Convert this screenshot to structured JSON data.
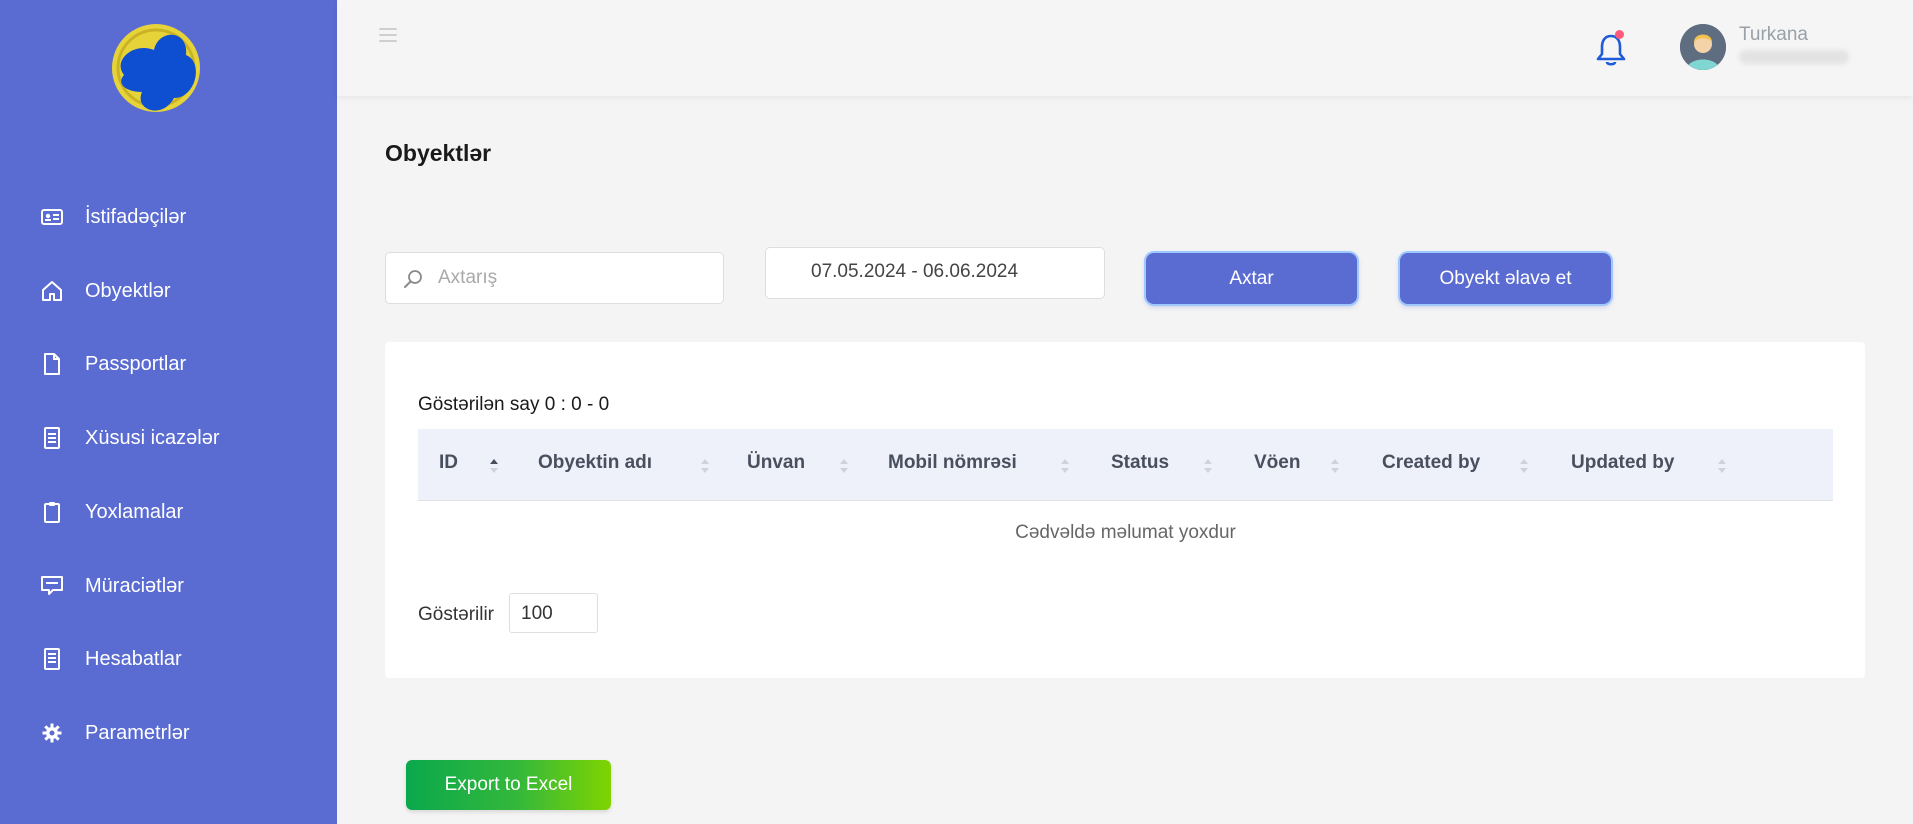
{
  "colors": {
    "sidebar": "#5a6bd1",
    "primary_button": "#5a6bd1",
    "excel_button": "#0aa84d",
    "notification_dot": "#ff5a7a"
  },
  "sidebar": {
    "logo": "logo-emblem",
    "items": [
      {
        "label": "İstifadəçilər",
        "icon": "id-card-icon"
      },
      {
        "label": "Obyektlər",
        "icon": "home-icon"
      },
      {
        "label": "Passportlar",
        "icon": "document-icon"
      },
      {
        "label": "Xüsusi icazələr",
        "icon": "list-document-icon"
      },
      {
        "label": "Yoxlamalar",
        "icon": "clipboard-icon"
      },
      {
        "label": "Müraciətlər",
        "icon": "message-icon"
      },
      {
        "label": "Hesabatlar",
        "icon": "report-icon"
      },
      {
        "label": "Parametrlər",
        "icon": "gear-icon"
      }
    ]
  },
  "header": {
    "menu_icon": "hamburger-icon",
    "notification_icon": "bell-icon",
    "user": {
      "name": "Turkana"
    }
  },
  "page": {
    "title": "Obyektlər"
  },
  "filters": {
    "search_placeholder": "Axtarış",
    "date_range": "07.05.2024 - 06.06.2024",
    "search_button": "Axtar",
    "add_button": "Obyekt əlavə et"
  },
  "table": {
    "shown_count": "Göstərilən say 0 : 0 - 0",
    "columns": [
      "ID",
      "Obyektin adı",
      "Ünvan",
      "Mobil nömrəsi",
      "Status",
      "Vöen",
      "Created by",
      "Updated by"
    ],
    "empty_message": "Cədvəldə məlumat yoxdur",
    "per_page_label": "Göstərilir",
    "per_page_value": "100"
  },
  "export_button": "Export to Excel"
}
